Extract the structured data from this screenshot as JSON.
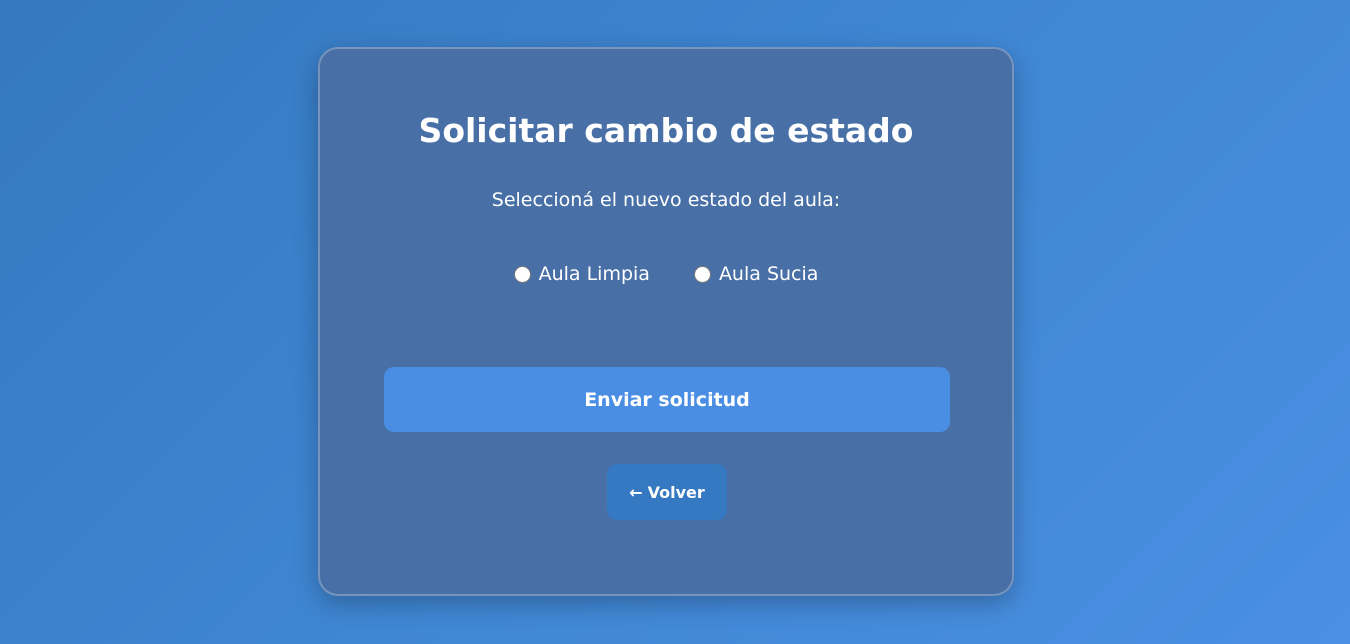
{
  "card": {
    "title": "Solicitar cambio de estado",
    "subtitle": "Seleccioná el nuevo estado del aula:",
    "options": [
      {
        "label": "Aula Limpia",
        "selected": false
      },
      {
        "label": "Aula Sucia",
        "selected": false
      }
    ],
    "submit_label": "Enviar solicitud",
    "back_label": "Volver",
    "back_icon": "←"
  },
  "colors": {
    "background_start": "#3578bf",
    "background_end": "#4a8fe2",
    "card_bg": "#4870a7",
    "submit_bg": "#4a8ee3",
    "back_bg": "#3579c2",
    "text": "#ffffff"
  }
}
